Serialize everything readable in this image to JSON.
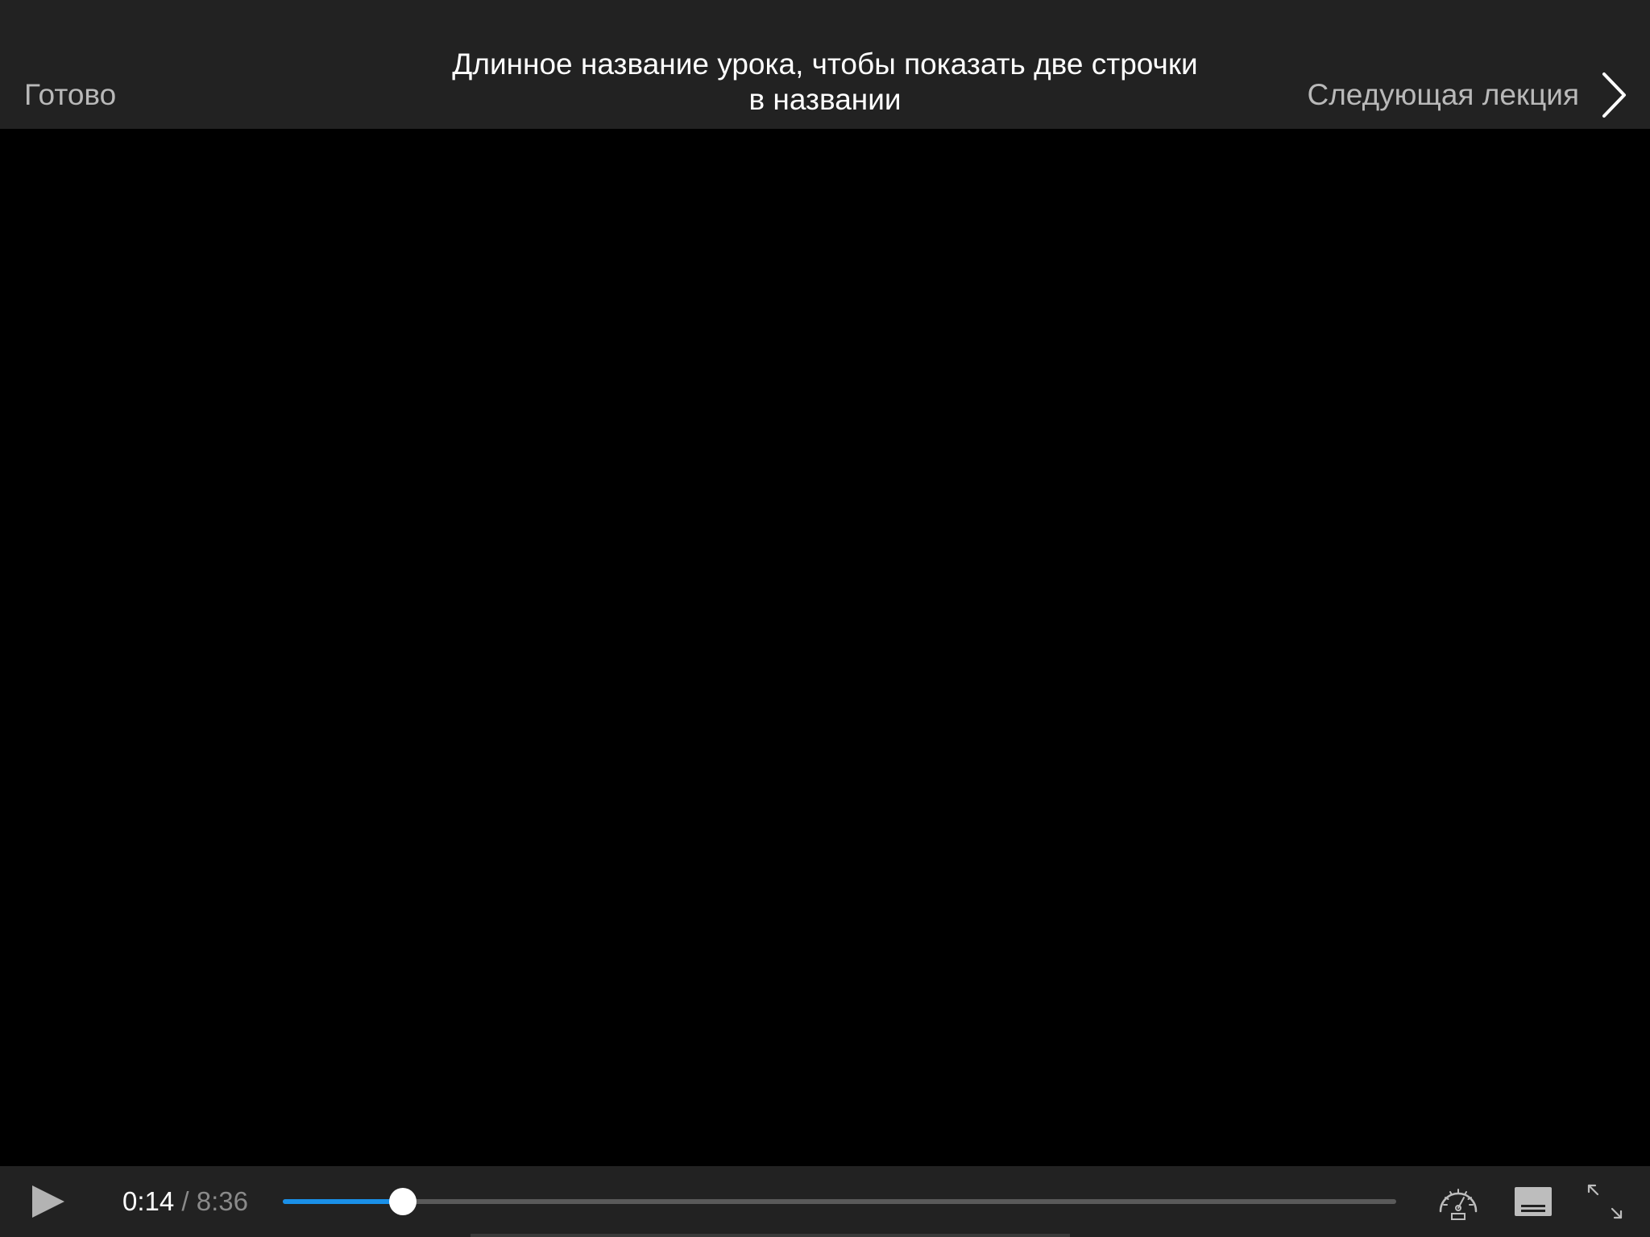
{
  "header": {
    "done_label": "Готово",
    "title": "Длинное название урока, чтобы показать две строчки в названии",
    "next_label": "Следующая лекция",
    "next_icon": "chevron-right-icon"
  },
  "player": {
    "current_time": "0:14",
    "separator": "/",
    "total_time": "8:36",
    "progress_fraction": 0.108,
    "accent_color": "#1a90e8",
    "controls": {
      "play_icon": "play-icon",
      "speed_icon": "speed-icon",
      "subtitles_icon": "subtitles-icon",
      "fullscreen_icon": "fullscreen-icon"
    }
  }
}
